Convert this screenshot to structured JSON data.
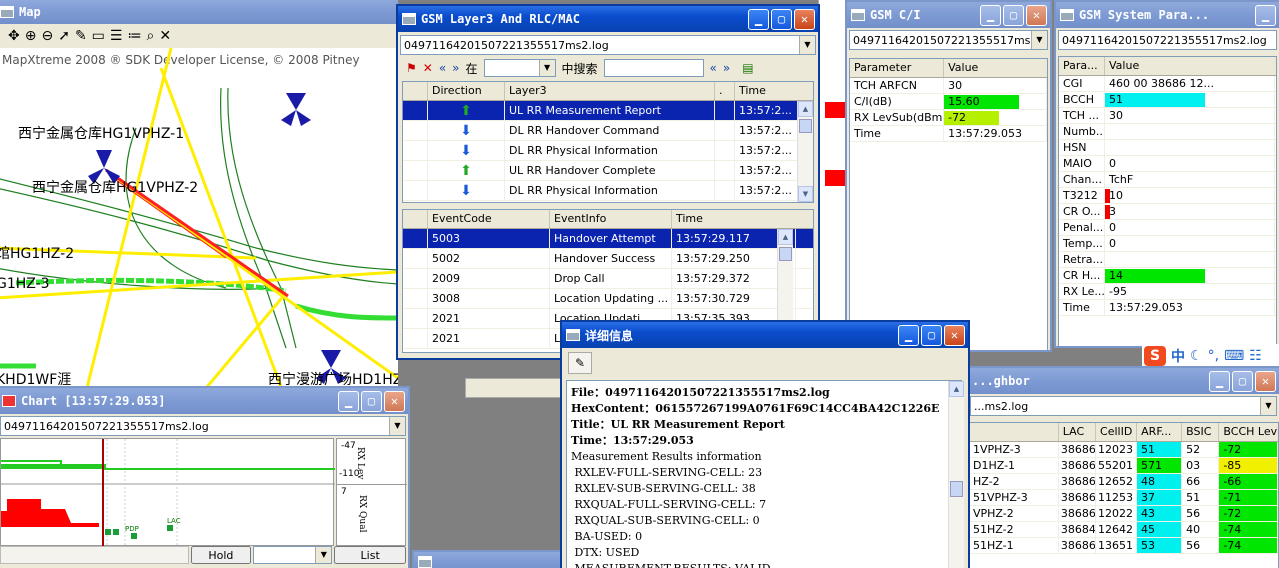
{
  "map": {
    "title": "Map",
    "copyright": "MapXtreme 2008 ® SDK Developer License, © 2008 Pitney",
    "labels": [
      "西宁金属仓库HG1VPHZ-1",
      "西宁金属仓库HG1VPHZ-2",
      "馆HG1HZ-2",
      "G1HZ-3",
      "KHD1WF涯",
      "西宁漫游广场HD1HZ-1"
    ]
  },
  "layer3": {
    "title": "GSM Layer3 And RLC/MAC",
    "file": "04971164201507221355517ms2.log",
    "search_in": "在",
    "search_label": "中搜索",
    "columns": [
      "Direction",
      "Layer3",
      ".",
      "Time"
    ],
    "rows": [
      {
        "dir": "up",
        "msg": "UL RR Measurement Report",
        "time": "13:57:2..."
      },
      {
        "dir": "down",
        "msg": "DL RR Handover Command",
        "time": "13:57:2..."
      },
      {
        "dir": "down",
        "msg": "DL RR Physical Information",
        "time": "13:57:2..."
      },
      {
        "dir": "up",
        "msg": "UL RR Handover Complete",
        "time": "13:57:2..."
      },
      {
        "dir": "down",
        "msg": "DL RR Physical Information",
        "time": "13:57:2..."
      }
    ],
    "event_columns": [
      "EventCode",
      "EventInfo",
      "Time"
    ],
    "events": [
      {
        "code": "5003",
        "info": "Handover Attempt",
        "time": "13:57:29.117"
      },
      {
        "code": "5002",
        "info": "Handover Success",
        "time": "13:57:29.250"
      },
      {
        "code": "2009",
        "info": "Drop Call",
        "time": "13:57:29.372"
      },
      {
        "code": "3008",
        "info": "Location Updating ...",
        "time": "13:57:30.729"
      },
      {
        "code": "2021",
        "info": "Location Updati...",
        "time": "13:57:35.393"
      },
      {
        "code": "2021",
        "info": "Lo...",
        "time": ""
      }
    ]
  },
  "ci": {
    "title": "GSM C/I",
    "file": "04971164201507221355517ms2.log",
    "columns": [
      "Parameter",
      "Value"
    ],
    "rows": [
      {
        "p": "TCH ARFCN",
        "v": "30",
        "bar": 0,
        "color": ""
      },
      {
        "p": "C/I(dB)",
        "v": "15.60",
        "bar": 0.75,
        "color": "#00e600"
      },
      {
        "p": "RX LevSub(dBm)",
        "v": "-72",
        "bar": 0.55,
        "color": "#b5f000"
      },
      {
        "p": "Time",
        "v": "13:57:29.053",
        "bar": 0,
        "color": ""
      }
    ]
  },
  "sys": {
    "title": "GSM System Para...",
    "file": "04971164201507221355517ms2.log",
    "columns": [
      "Para...",
      "Value"
    ],
    "rows": [
      {
        "p": "CGI",
        "v": "460 00 38686 12...",
        "bar": 0,
        "color": ""
      },
      {
        "p": "BCCH",
        "v": "51",
        "bar": 1,
        "color": "#00f0f0"
      },
      {
        "p": "TCH ...",
        "v": "30",
        "bar": 0,
        "color": ""
      },
      {
        "p": "Numb...",
        "v": "",
        "bar": 0,
        "color": ""
      },
      {
        "p": "HSN",
        "v": "",
        "bar": 0,
        "color": ""
      },
      {
        "p": "MAIO",
        "v": "0",
        "bar": 0,
        "color": ""
      },
      {
        "p": "Chan...",
        "v": "TchF",
        "bar": 0,
        "color": ""
      },
      {
        "p": "T3212",
        "v": "10",
        "bar": 0.05,
        "color": "#f00000"
      },
      {
        "p": "CR O...",
        "v": "3",
        "bar": 0.05,
        "color": "#f00000"
      },
      {
        "p": "Penal...",
        "v": "0",
        "bar": 0,
        "color": ""
      },
      {
        "p": "Temp...",
        "v": "0",
        "bar": 0,
        "color": ""
      },
      {
        "p": "Retra...",
        "v": "",
        "bar": 0,
        "color": ""
      },
      {
        "p": "CR H...",
        "v": "14",
        "bar": 1,
        "color": "#00e600"
      },
      {
        "p": "RX Le...",
        "v": "-95",
        "bar": 0,
        "color": ""
      },
      {
        "p": "Time",
        "v": "13:57:29.053",
        "bar": 0,
        "color": ""
      }
    ]
  },
  "neighbor": {
    "title": "...ghbor",
    "file": "...ms2.log",
    "columns": [
      "",
      "LAC",
      "CellID",
      "ARF...",
      "BSIC",
      "BCCH Lev"
    ],
    "rows": [
      {
        "n": "1VPHZ-3",
        "lac": "38686",
        "cid": "12023",
        "arf": "51",
        "arfc": "#00f0f0",
        "bsic": "52",
        "lev": "-72",
        "levc": "#00e600"
      },
      {
        "n": "D1HZ-1",
        "lac": "38686",
        "cid": "55201",
        "arf": "571",
        "arfc": "#00e600",
        "bsic": "03",
        "lev": "-85",
        "levc": "#f0f000"
      },
      {
        "n": "HZ-2",
        "lac": "38686",
        "cid": "12652",
        "arf": "48",
        "arfc": "#00f0f0",
        "bsic": "66",
        "lev": "-66",
        "levc": "#00e600"
      },
      {
        "n": "51VPHZ-3",
        "lac": "38686",
        "cid": "11253",
        "arf": "37",
        "arfc": "#00f0f0",
        "bsic": "51",
        "lev": "-71",
        "levc": "#00e600"
      },
      {
        "n": "VPHZ-2",
        "lac": "38686",
        "cid": "12022",
        "arf": "43",
        "arfc": "#00f0f0",
        "bsic": "56",
        "lev": "-72",
        "levc": "#00e600"
      },
      {
        "n": "51HZ-2",
        "lac": "38684",
        "cid": "12642",
        "arf": "45",
        "arfc": "#00f0f0",
        "bsic": "40",
        "lev": "-74",
        "levc": "#00e600"
      },
      {
        "n": "51HZ-1",
        "lac": "38686",
        "cid": "13651",
        "arf": "53",
        "arfc": "#00f0f0",
        "bsic": "56",
        "lev": "-74",
        "levc": "#00e600"
      }
    ]
  },
  "chart": {
    "title": "Chart [13:57:29.053]",
    "file": "04971164201507221355517ms2.log",
    "ax1_top": "-47",
    "ax1_bot": "-110",
    "ax1_name": "RX Lev",
    "ax2_top": "7",
    "ax2_name": "RX Qual",
    "hold": "Hold",
    "list": "List",
    "event_labels": [
      "PDP",
      "LAC"
    ]
  },
  "detail": {
    "title": "详细信息",
    "lines": [
      {
        "t": "File：04971164201507221355517ms2.log",
        "bold": true
      },
      {
        "t": "HexContent：061557267199A0761F69C14CC4BA42C1226E",
        "bold": true
      },
      {
        "t": "Title：UL RR Measurement Report",
        "bold": true
      },
      {
        "t": "Time：13:57:29.053",
        "bold": true
      },
      {
        "t": "Measurement Results information",
        "bold": false
      },
      {
        "t": " RXLEV-FULL-SERVING-CELL: 23",
        "bold": false
      },
      {
        "t": " RXLEV-SUB-SERVING-CELL: 38",
        "bold": false
      },
      {
        "t": " RXQUAL-FULL-SERVING-CELL: 7",
        "bold": false
      },
      {
        "t": " RXQUAL-SUB-SERVING-CELL: 0",
        "bold": false
      },
      {
        "t": " BA-USED: 0",
        "bold": false
      },
      {
        "t": " DTX: USED",
        "bold": false
      },
      {
        "t": " MEASUREMENT-RESULTS: VALID",
        "bold": false
      }
    ]
  },
  "ime": {
    "brand": "S",
    "lang": "中"
  }
}
